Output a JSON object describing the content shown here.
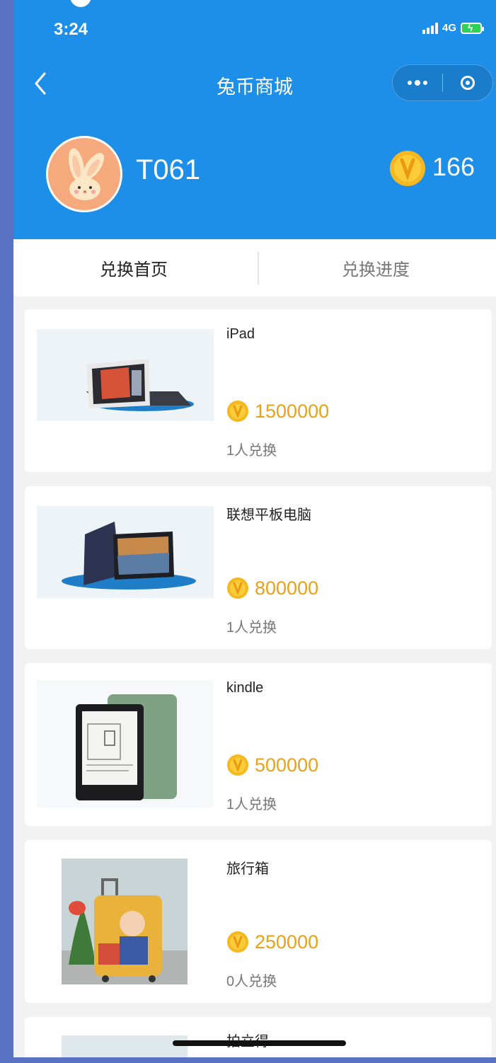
{
  "status_bar": {
    "time": "3:24",
    "network": "4G"
  },
  "nav": {
    "title": "兔币商城"
  },
  "user": {
    "name": "T061",
    "coins": "166"
  },
  "tabs": [
    {
      "label": "兑换首页"
    },
    {
      "label": "兑换进度"
    }
  ],
  "products": [
    {
      "name": "iPad",
      "price": "1500000",
      "exchanged": "1人兑换"
    },
    {
      "name": "联想平板电脑",
      "price": "800000",
      "exchanged": "1人兑换"
    },
    {
      "name": "kindle",
      "price": "500000",
      "exchanged": "1人兑换"
    },
    {
      "name": "旅行箱",
      "price": "250000",
      "exchanged": "0人兑换"
    },
    {
      "name": "拍立得"
    }
  ],
  "colors": {
    "header_bg": "#1e8fe8",
    "price": "#e8a21a",
    "coin": "#f5b820"
  },
  "icons": {
    "back": "chevron-left-icon",
    "more": "more-dots-icon",
    "close": "close-circle-icon",
    "coin": "coin-icon"
  }
}
